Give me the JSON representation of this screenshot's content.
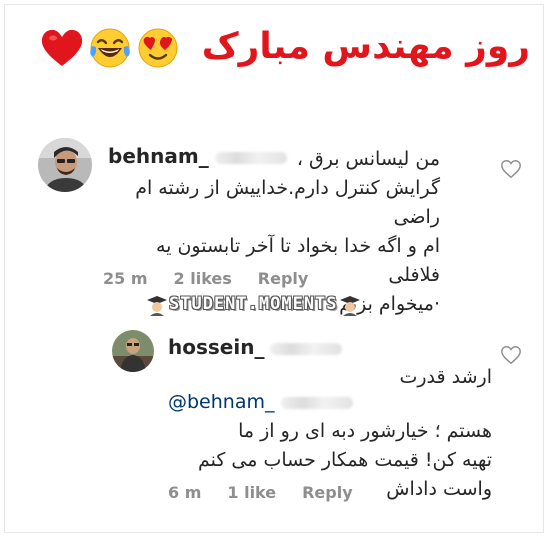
{
  "banner": {
    "title": "روز مهندس مبارک",
    "emojis": [
      "heart-emoji",
      "laughing-tears-emoji",
      "heart-eyes-emoji"
    ]
  },
  "comment1": {
    "username": "behnam_",
    "lines": [
      "من لیسانس برق ،",
      "گرایش کنترل دارم.خداییش از رشته ام راضی",
      "ام و اگه خدا بخواد تا آخر تابستون یه فلافلی",
      "·میخوام بزنم"
    ],
    "time": "25 m",
    "likes": "2 likes",
    "reply": "Reply"
  },
  "watermark": {
    "text": "STUDENT.MOMENTS"
  },
  "comment2": {
    "username": "hossein_",
    "lines_top": "ارشد قدرت",
    "mention": "@behnam_",
    "lines": [
      "هستم ؛ خیارشور دبه ای رو از ما",
      "تهیه کن! قیمت همکار حساب می کنم",
      "واست داداش"
    ],
    "time": "6 m",
    "likes": "1 like",
    "reply": "Reply"
  },
  "colors": {
    "banner_red": "#e0161c",
    "meta_gray": "#8e8e8e",
    "mention_blue": "#00376b"
  }
}
